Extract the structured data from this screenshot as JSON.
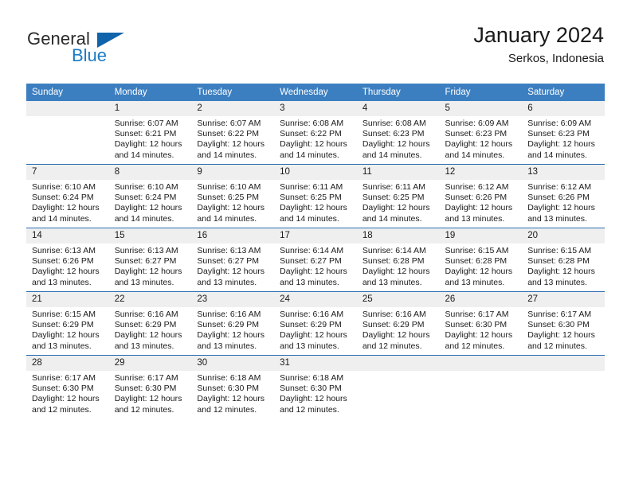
{
  "brand": {
    "general": "General",
    "blue": "Blue",
    "triangle_color": "#1064ab",
    "blue_color": "#1a7bc4"
  },
  "header": {
    "title": "January 2024",
    "subtitle": "Serkos, Indonesia"
  },
  "colors": {
    "header_row": "#3c7fc0",
    "row_divider": "#2a6cb0",
    "daynum_band": "#efefef"
  },
  "weekdays": [
    "Sunday",
    "Monday",
    "Tuesday",
    "Wednesday",
    "Thursday",
    "Friday",
    "Saturday"
  ],
  "labels": {
    "sunrise_prefix": "Sunrise: ",
    "sunset_prefix": "Sunset: ",
    "daylight_prefix": "Daylight: "
  },
  "weeks": [
    [
      {
        "day": "",
        "blank": true
      },
      {
        "day": "1",
        "sunrise": "Sunrise: 6:07 AM",
        "sunset": "Sunset: 6:21 PM",
        "daylight_1": "Daylight: 12 hours",
        "daylight_2": "and 14 minutes."
      },
      {
        "day": "2",
        "sunrise": "Sunrise: 6:07 AM",
        "sunset": "Sunset: 6:22 PM",
        "daylight_1": "Daylight: 12 hours",
        "daylight_2": "and 14 minutes."
      },
      {
        "day": "3",
        "sunrise": "Sunrise: 6:08 AM",
        "sunset": "Sunset: 6:22 PM",
        "daylight_1": "Daylight: 12 hours",
        "daylight_2": "and 14 minutes."
      },
      {
        "day": "4",
        "sunrise": "Sunrise: 6:08 AM",
        "sunset": "Sunset: 6:23 PM",
        "daylight_1": "Daylight: 12 hours",
        "daylight_2": "and 14 minutes."
      },
      {
        "day": "5",
        "sunrise": "Sunrise: 6:09 AM",
        "sunset": "Sunset: 6:23 PM",
        "daylight_1": "Daylight: 12 hours",
        "daylight_2": "and 14 minutes."
      },
      {
        "day": "6",
        "sunrise": "Sunrise: 6:09 AM",
        "sunset": "Sunset: 6:23 PM",
        "daylight_1": "Daylight: 12 hours",
        "daylight_2": "and 14 minutes."
      }
    ],
    [
      {
        "day": "7",
        "sunrise": "Sunrise: 6:10 AM",
        "sunset": "Sunset: 6:24 PM",
        "daylight_1": "Daylight: 12 hours",
        "daylight_2": "and 14 minutes."
      },
      {
        "day": "8",
        "sunrise": "Sunrise: 6:10 AM",
        "sunset": "Sunset: 6:24 PM",
        "daylight_1": "Daylight: 12 hours",
        "daylight_2": "and 14 minutes."
      },
      {
        "day": "9",
        "sunrise": "Sunrise: 6:10 AM",
        "sunset": "Sunset: 6:25 PM",
        "daylight_1": "Daylight: 12 hours",
        "daylight_2": "and 14 minutes."
      },
      {
        "day": "10",
        "sunrise": "Sunrise: 6:11 AM",
        "sunset": "Sunset: 6:25 PM",
        "daylight_1": "Daylight: 12 hours",
        "daylight_2": "and 14 minutes."
      },
      {
        "day": "11",
        "sunrise": "Sunrise: 6:11 AM",
        "sunset": "Sunset: 6:25 PM",
        "daylight_1": "Daylight: 12 hours",
        "daylight_2": "and 14 minutes."
      },
      {
        "day": "12",
        "sunrise": "Sunrise: 6:12 AM",
        "sunset": "Sunset: 6:26 PM",
        "daylight_1": "Daylight: 12 hours",
        "daylight_2": "and 13 minutes."
      },
      {
        "day": "13",
        "sunrise": "Sunrise: 6:12 AM",
        "sunset": "Sunset: 6:26 PM",
        "daylight_1": "Daylight: 12 hours",
        "daylight_2": "and 13 minutes."
      }
    ],
    [
      {
        "day": "14",
        "sunrise": "Sunrise: 6:13 AM",
        "sunset": "Sunset: 6:26 PM",
        "daylight_1": "Daylight: 12 hours",
        "daylight_2": "and 13 minutes."
      },
      {
        "day": "15",
        "sunrise": "Sunrise: 6:13 AM",
        "sunset": "Sunset: 6:27 PM",
        "daylight_1": "Daylight: 12 hours",
        "daylight_2": "and 13 minutes."
      },
      {
        "day": "16",
        "sunrise": "Sunrise: 6:13 AM",
        "sunset": "Sunset: 6:27 PM",
        "daylight_1": "Daylight: 12 hours",
        "daylight_2": "and 13 minutes."
      },
      {
        "day": "17",
        "sunrise": "Sunrise: 6:14 AM",
        "sunset": "Sunset: 6:27 PM",
        "daylight_1": "Daylight: 12 hours",
        "daylight_2": "and 13 minutes."
      },
      {
        "day": "18",
        "sunrise": "Sunrise: 6:14 AM",
        "sunset": "Sunset: 6:28 PM",
        "daylight_1": "Daylight: 12 hours",
        "daylight_2": "and 13 minutes."
      },
      {
        "day": "19",
        "sunrise": "Sunrise: 6:15 AM",
        "sunset": "Sunset: 6:28 PM",
        "daylight_1": "Daylight: 12 hours",
        "daylight_2": "and 13 minutes."
      },
      {
        "day": "20",
        "sunrise": "Sunrise: 6:15 AM",
        "sunset": "Sunset: 6:28 PM",
        "daylight_1": "Daylight: 12 hours",
        "daylight_2": "and 13 minutes."
      }
    ],
    [
      {
        "day": "21",
        "sunrise": "Sunrise: 6:15 AM",
        "sunset": "Sunset: 6:29 PM",
        "daylight_1": "Daylight: 12 hours",
        "daylight_2": "and 13 minutes."
      },
      {
        "day": "22",
        "sunrise": "Sunrise: 6:16 AM",
        "sunset": "Sunset: 6:29 PM",
        "daylight_1": "Daylight: 12 hours",
        "daylight_2": "and 13 minutes."
      },
      {
        "day": "23",
        "sunrise": "Sunrise: 6:16 AM",
        "sunset": "Sunset: 6:29 PM",
        "daylight_1": "Daylight: 12 hours",
        "daylight_2": "and 13 minutes."
      },
      {
        "day": "24",
        "sunrise": "Sunrise: 6:16 AM",
        "sunset": "Sunset: 6:29 PM",
        "daylight_1": "Daylight: 12 hours",
        "daylight_2": "and 13 minutes."
      },
      {
        "day": "25",
        "sunrise": "Sunrise: 6:16 AM",
        "sunset": "Sunset: 6:29 PM",
        "daylight_1": "Daylight: 12 hours",
        "daylight_2": "and 12 minutes."
      },
      {
        "day": "26",
        "sunrise": "Sunrise: 6:17 AM",
        "sunset": "Sunset: 6:30 PM",
        "daylight_1": "Daylight: 12 hours",
        "daylight_2": "and 12 minutes."
      },
      {
        "day": "27",
        "sunrise": "Sunrise: 6:17 AM",
        "sunset": "Sunset: 6:30 PM",
        "daylight_1": "Daylight: 12 hours",
        "daylight_2": "and 12 minutes."
      }
    ],
    [
      {
        "day": "28",
        "sunrise": "Sunrise: 6:17 AM",
        "sunset": "Sunset: 6:30 PM",
        "daylight_1": "Daylight: 12 hours",
        "daylight_2": "and 12 minutes."
      },
      {
        "day": "29",
        "sunrise": "Sunrise: 6:17 AM",
        "sunset": "Sunset: 6:30 PM",
        "daylight_1": "Daylight: 12 hours",
        "daylight_2": "and 12 minutes."
      },
      {
        "day": "30",
        "sunrise": "Sunrise: 6:18 AM",
        "sunset": "Sunset: 6:30 PM",
        "daylight_1": "Daylight: 12 hours",
        "daylight_2": "and 12 minutes."
      },
      {
        "day": "31",
        "sunrise": "Sunrise: 6:18 AM",
        "sunset": "Sunset: 6:30 PM",
        "daylight_1": "Daylight: 12 hours",
        "daylight_2": "and 12 minutes."
      },
      {
        "day": "",
        "blank": true
      },
      {
        "day": "",
        "blank": true
      },
      {
        "day": "",
        "blank": true
      }
    ]
  ]
}
